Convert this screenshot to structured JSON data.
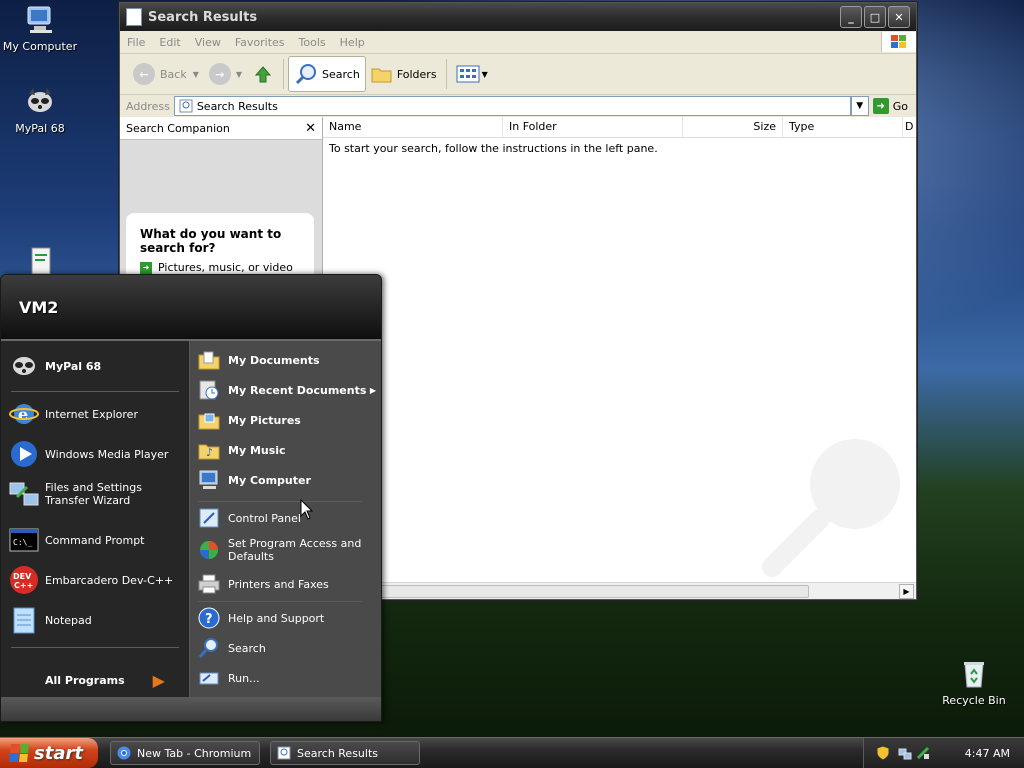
{
  "desktop": {
    "icons": [
      {
        "label": "My Computer"
      },
      {
        "label": "MyPal 68"
      },
      {
        "label": "Recycle Bin"
      }
    ]
  },
  "window": {
    "title": "Search Results",
    "menu": [
      "File",
      "Edit",
      "View",
      "Favorites",
      "Tools",
      "Help"
    ],
    "toolbar": {
      "back": "Back",
      "search": "Search",
      "folders": "Folders"
    },
    "address": {
      "label": "Address",
      "value": "Search Results",
      "go": "Go"
    },
    "companion": {
      "title": "Search Companion",
      "question": "What do you want to search for?",
      "option": "Pictures, music, or video"
    },
    "columns": [
      "Name",
      "In Folder",
      "Size",
      "Type",
      "D"
    ],
    "message": "To start your search, follow the instructions in the left pane."
  },
  "start_menu": {
    "user": "VM2",
    "pinned": [
      {
        "label": "MyPal 68"
      }
    ],
    "recent": [
      {
        "label": "Internet Explorer"
      },
      {
        "label": "Windows Media Player"
      },
      {
        "label": "Files and Settings Transfer Wizard"
      },
      {
        "label": "Command Prompt"
      },
      {
        "label": "Embarcadero Dev-C++"
      },
      {
        "label": "Notepad"
      }
    ],
    "all_programs": "All Programs",
    "places": [
      {
        "label": "My Documents"
      },
      {
        "label": "My Recent Documents"
      },
      {
        "label": "My Pictures"
      },
      {
        "label": "My Music"
      },
      {
        "label": "My Computer"
      }
    ],
    "system": [
      {
        "label": "Control Panel"
      },
      {
        "label": "Set Program Access and Defaults"
      },
      {
        "label": "Printers and Faxes"
      }
    ],
    "help": [
      {
        "label": "Help and Support"
      },
      {
        "label": "Search"
      },
      {
        "label": "Run..."
      }
    ]
  },
  "taskbar": {
    "start": "start",
    "tasks": [
      {
        "label": "New Tab - Chromium"
      },
      {
        "label": "Search Results"
      }
    ],
    "clock": "4:47 AM"
  }
}
